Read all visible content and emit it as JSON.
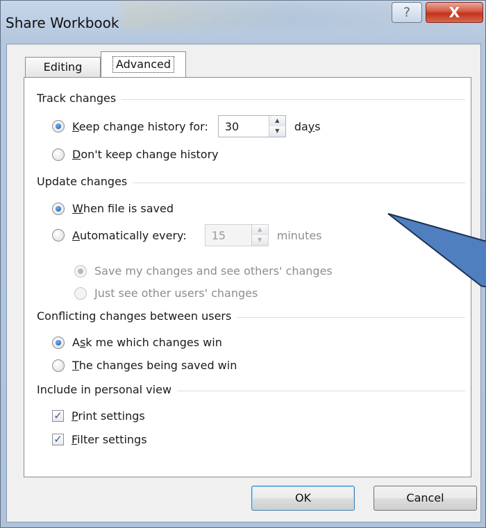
{
  "window": {
    "title": "Share Workbook",
    "help_glyph": "?",
    "close_glyph": "X"
  },
  "tabs": [
    {
      "label": "Editing",
      "active": false
    },
    {
      "label": "Advanced",
      "active": true
    }
  ],
  "track_changes": {
    "heading": "Track changes",
    "keep_history": {
      "prefix": "",
      "accel": "K",
      "rest": "eep change history for:",
      "checked": true
    },
    "days_value": "30",
    "days_label_pre": "da",
    "days_label_accel": "y",
    "days_label_post": "s",
    "dont_keep": {
      "accel": "D",
      "rest": "on't keep change history",
      "checked": false
    }
  },
  "update_changes": {
    "heading": "Update changes",
    "when_saved": {
      "accel": "W",
      "rest": "hen file is saved",
      "checked": true
    },
    "auto_every": {
      "accel": "A",
      "rest": "utomatically every:",
      "checked": false
    },
    "minutes_value": "15",
    "minutes_label": "minutes",
    "save_and_see": {
      "label": "Save my changes and see others' changes",
      "checked": true,
      "enabled": false
    },
    "just_see": {
      "label": "Just see other users' changes",
      "checked": false,
      "enabled": false
    }
  },
  "conflicts": {
    "heading": "Conflicting changes between users",
    "ask_me": {
      "pre": "A",
      "accel": "s",
      "rest": "k me which changes win",
      "checked": true
    },
    "being_saved": {
      "accel": "T",
      "rest": "he changes being saved win",
      "checked": false
    }
  },
  "personal_view": {
    "heading": "Include in personal view",
    "print": {
      "accel": "P",
      "rest": "rint settings",
      "checked": true
    },
    "filter": {
      "accel": "F",
      "rest": "ilter settings",
      "checked": true
    }
  },
  "buttons": {
    "ok": "OK",
    "cancel": "Cancel"
  },
  "colors": {
    "annotation_arrow_fill": "#4f7fbf",
    "annotation_arrow_stroke": "#1d2f52"
  }
}
